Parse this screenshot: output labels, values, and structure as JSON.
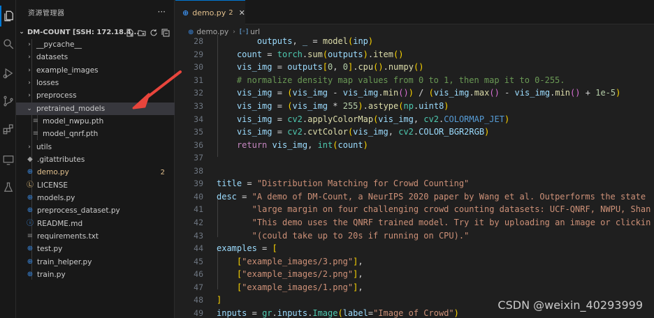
{
  "explorer": {
    "title": "资源管理器",
    "more": "···",
    "root_label": "DM-COUNT [SSH: 172.18.4...",
    "items": [
      {
        "label": "__pycache__",
        "kind": "folder"
      },
      {
        "label": "datasets",
        "kind": "folder"
      },
      {
        "label": "example_images",
        "kind": "folder"
      },
      {
        "label": "losses",
        "kind": "folder"
      },
      {
        "label": "preprocess",
        "kind": "folder"
      },
      {
        "label": "pretrained_models",
        "kind": "folder-open"
      },
      {
        "label": "model_nwpu.pth",
        "kind": "file-lines"
      },
      {
        "label": "model_qnrf.pth",
        "kind": "file-lines"
      },
      {
        "label": "utils",
        "kind": "folder"
      },
      {
        "label": ".gitattributes",
        "kind": "git"
      },
      {
        "label": "demo.py",
        "kind": "python",
        "badge": "2"
      },
      {
        "label": "LICENSE",
        "kind": "license"
      },
      {
        "label": "models.py",
        "kind": "python"
      },
      {
        "label": "preprocess_dataset.py",
        "kind": "python"
      },
      {
        "label": "README.md",
        "kind": "info"
      },
      {
        "label": "requirements.txt",
        "kind": "file-lines"
      },
      {
        "label": "test.py",
        "kind": "python"
      },
      {
        "label": "train_helper.py",
        "kind": "python"
      },
      {
        "label": "train.py",
        "kind": "python"
      }
    ]
  },
  "editor": {
    "tab": {
      "name": "demo.py",
      "problems": "2",
      "close": "✕"
    },
    "breadcrumb": {
      "file": "demo.py",
      "symbol": "url"
    },
    "line_numbers": [
      "28",
      "29",
      "30",
      "31",
      "32",
      "33",
      "34",
      "35",
      "36",
      "37",
      "38",
      "39",
      "40",
      "41",
      "42",
      "43",
      "44",
      "45",
      "46",
      "47",
      "48",
      "49"
    ],
    "code": [
      "        outputs, _ = model(inp)",
      "    count = torch.sum(outputs).item()",
      "    vis_img = outputs[0, 0].cpu().numpy()",
      "    # normalize density map values from 0 to 1, then map it to 0-255.",
      "    vis_img = (vis_img - vis_img.min()) / (vis_img.max() - vis_img.min() + 1e-5)",
      "    vis_img = (vis_img * 255).astype(np.uint8)",
      "    vis_img = cv2.applyColorMap(vis_img, cv2.COLORMAP_JET)",
      "    vis_img = cv2.cvtColor(vis_img, cv2.COLOR_BGR2RGB)",
      "    return vis_img, int(count)",
      "",
      "",
      "title = \"Distribution Matching for Crowd Counting\"",
      "desc = \"A demo of DM-Count, a NeurIPS 2020 paper by Wang et al. Outperforms the state",
      "       \"large margin on four challenging crowd counting datasets: UCF-QNRF, NWPU, Shan",
      "       \"This demo uses the QNRF trained model. Try it by uploading an image or clickin",
      "       \"(could take up to 20s if running on CPU).\"",
      "examples = [",
      "    [\"example_images/3.png\"],",
      "    [\"example_images/2.png\"],",
      "    [\"example_images/1.png\"],",
      "]",
      "inputs = gr.inputs.Image(label=\"Image of Crowd\")"
    ]
  },
  "watermark": "CSDN @weixin_40293999",
  "colors": {
    "accent": "#0078d4",
    "arrow": "#e8453c",
    "modified": "#e2c08d"
  }
}
